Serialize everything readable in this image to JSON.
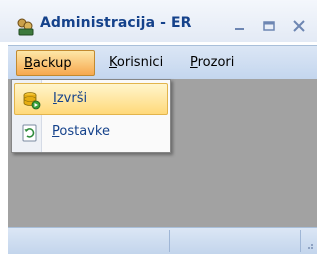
{
  "window": {
    "title": "Administracija - ER",
    "icon": "app-icon"
  },
  "titlebar_buttons": {
    "minimize_icon": "minimize-icon",
    "maximize_icon": "maximize-icon",
    "close_icon": "close-icon"
  },
  "menubar": {
    "items": [
      {
        "label_mnemonic": "B",
        "label_rest": "ackup",
        "active": true
      },
      {
        "label_mnemonic": "K",
        "label_rest": "orisnici",
        "active": false
      },
      {
        "label_mnemonic": "P",
        "label_rest": "rozori",
        "active": false
      }
    ]
  },
  "dropdown": {
    "items": [
      {
        "label_mnemonic": "I",
        "label_rest": "zvrši",
        "icon": "database-run-icon",
        "highlighted": true
      },
      {
        "label_mnemonic": "P",
        "label_rest": "ostavke",
        "icon": "settings-refresh-icon",
        "highlighted": false
      }
    ]
  },
  "colors": {
    "title_text": "#15428b",
    "menu_active": "#f7a84e",
    "client_background": "#a2a2a2"
  }
}
